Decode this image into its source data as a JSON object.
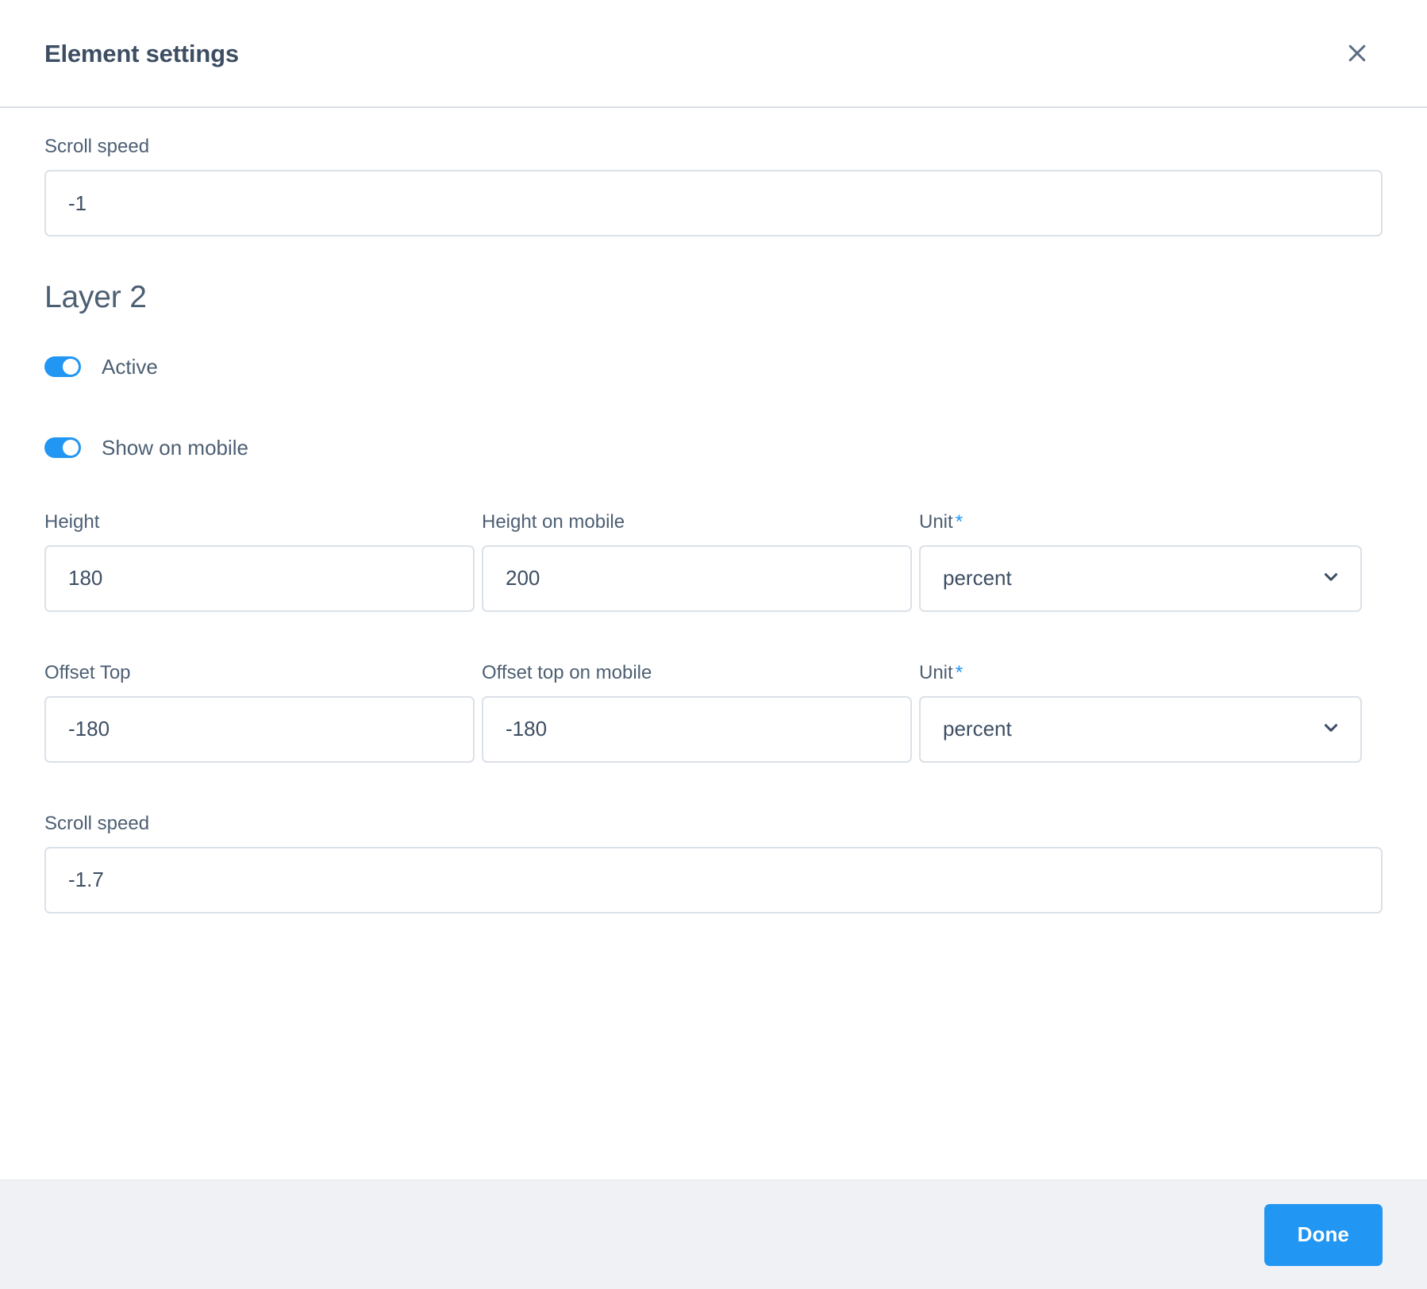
{
  "dialog": {
    "title": "Element settings",
    "close_icon": "close-icon"
  },
  "top_field": {
    "label": "Scroll speed",
    "value": "-1"
  },
  "section": {
    "title": "Layer 2"
  },
  "toggles": [
    {
      "label": "Active",
      "state": "on"
    },
    {
      "label": "Show on mobile",
      "state": "on"
    }
  ],
  "height_row": {
    "desktop": {
      "label": "Height",
      "value": "180"
    },
    "mobile": {
      "label": "Height on mobile",
      "value": "200"
    },
    "unit": {
      "label": "Unit",
      "required_marker": "*",
      "value": "percent",
      "chevron_icon": "chevron-down-icon"
    }
  },
  "offset_row": {
    "desktop": {
      "label": "Offset Top",
      "value": "-180"
    },
    "mobile": {
      "label": "Offset top on mobile",
      "value": "-180"
    },
    "unit": {
      "label": "Unit",
      "required_marker": "*",
      "value": "percent",
      "chevron_icon": "chevron-down-icon"
    }
  },
  "bottom_field": {
    "label": "Scroll speed",
    "value": "-1.7"
  },
  "footer": {
    "done_label": "Done"
  },
  "colors": {
    "accent": "#2196f3",
    "text": "#4d5f73",
    "value_text": "#3d4e63",
    "border": "#dbe1e8",
    "footer_bg": "#f0f1f5",
    "header_divider": "#d9dee5"
  }
}
